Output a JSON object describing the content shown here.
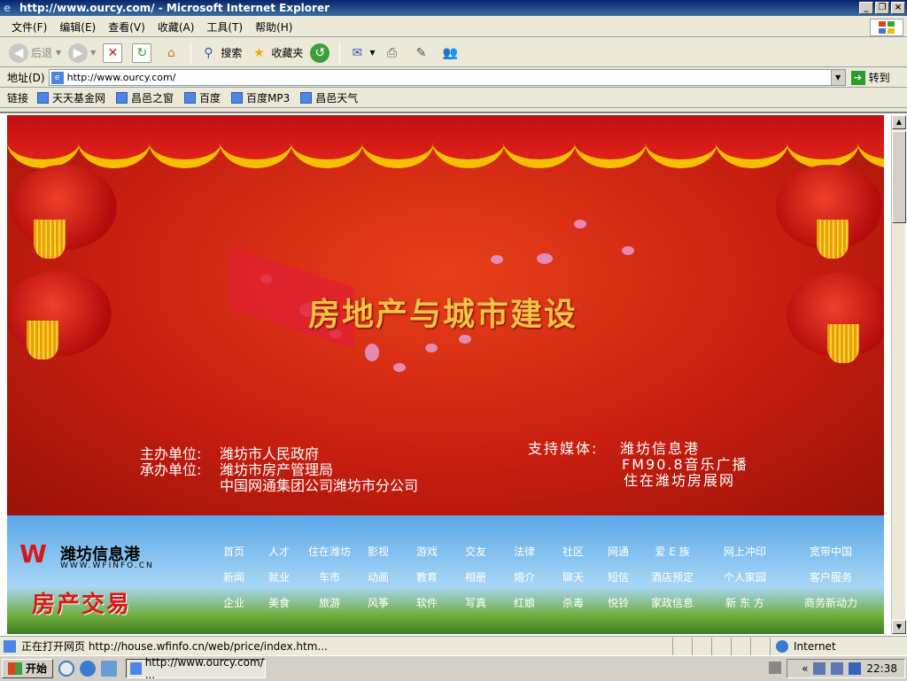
{
  "window": {
    "title": "http://www.ourcy.com/ - Microsoft Internet Explorer",
    "buttons": [
      "_",
      "❐",
      "×"
    ]
  },
  "menu": [
    "文件(F)",
    "编辑(E)",
    "查看(V)",
    "收藏(A)",
    "工具(T)",
    "帮助(H)"
  ],
  "toolbar": {
    "back": "后退",
    "search": "搜索",
    "favorites": "收藏夹"
  },
  "address": {
    "label": "地址(D)",
    "value": "http://www.ourcy.com/",
    "go": "转到"
  },
  "links": {
    "label": "链接",
    "items": [
      "天天基金网",
      "昌邑之窗",
      "百度",
      "百度MP3",
      "昌邑天气"
    ]
  },
  "banner": {
    "title": "房地产与城市建设",
    "organizer_label": "主办单位:",
    "organizer": "潍坊市人民政府",
    "undertaker_label": "承办单位:",
    "undertaker": "潍坊市房产管理局",
    "undertaker2": "中国网通集团公司潍坊市分公司",
    "media_label": "支持媒体:",
    "media1": "潍坊信息港",
    "media2": "FM90.8音乐广播",
    "media3": "住在潍坊房展网"
  },
  "portal": {
    "name": "潍坊信息港",
    "url": "WWW.WFINFO.CN",
    "section": "房产交易",
    "nav": [
      [
        "首页",
        "人才",
        "住在潍坊",
        "影视",
        "游戏",
        "交友",
        "法律",
        "社区",
        "网通",
        "爱 E 族",
        "网上冲印",
        "宽带中国"
      ],
      [
        "新闻",
        "就业",
        "车市",
        "动画",
        "教育",
        "相册",
        "婚介",
        "聊天",
        "短信",
        "酒店预定",
        "个人家园",
        "客户服务"
      ],
      [
        "企业",
        "美食",
        "旅游",
        "风筝",
        "软件",
        "写真",
        "红娘",
        "杀毒",
        "悦铃",
        "家政信息",
        "新 东 方",
        "商务新动力"
      ]
    ]
  },
  "status": {
    "text": "正在打开网页 http://house.wfinfo.cn/web/price/index.htm...",
    "zone": "Internet"
  },
  "taskbar": {
    "start": "开始",
    "item": "http://www.ourcy.com/ ...",
    "clock": "22:38",
    "chevron": "«"
  }
}
